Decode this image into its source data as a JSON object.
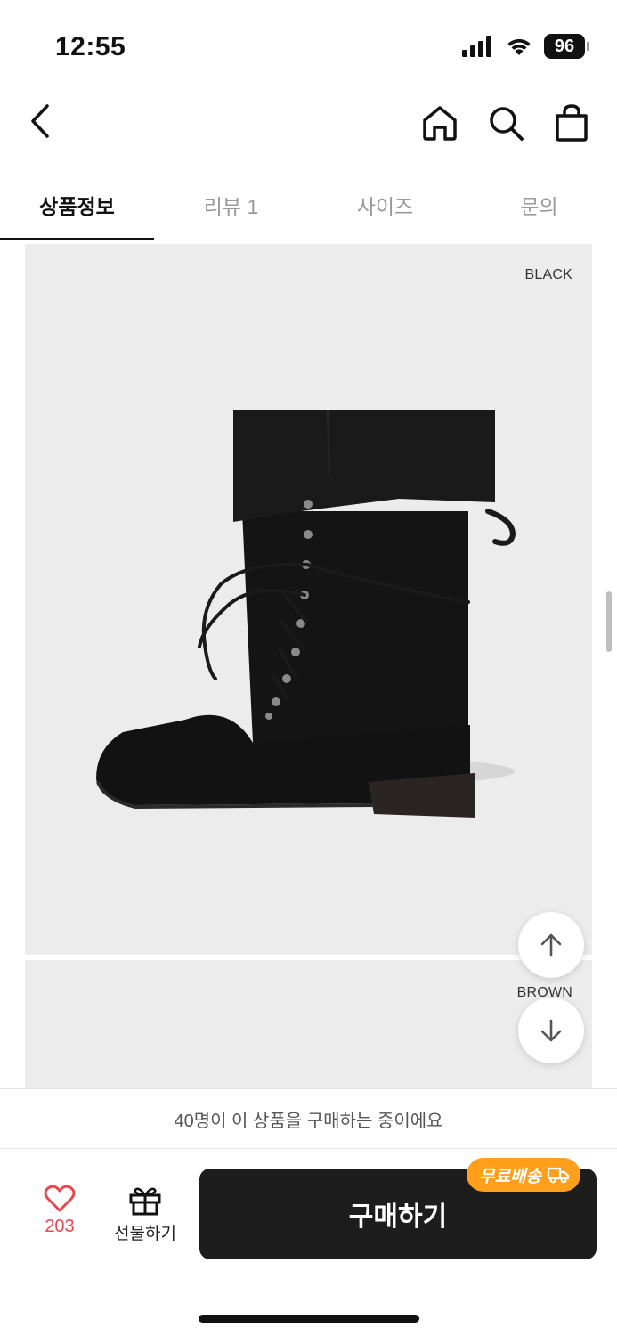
{
  "status_bar": {
    "time": "12:55",
    "battery": "96"
  },
  "header": {
    "back_icon": "chevron-left-icon",
    "home_icon": "home-icon",
    "search_icon": "search-icon",
    "bag_icon": "shopping-bag-icon"
  },
  "tabs": [
    {
      "label": "상품정보",
      "active": true
    },
    {
      "label": "리뷰 1",
      "active": false
    },
    {
      "label": "사이즈",
      "active": false
    },
    {
      "label": "문의",
      "active": false
    }
  ],
  "product_images": [
    {
      "color_label": "BLACK"
    },
    {
      "color_label": "BROWN"
    }
  ],
  "floating": {
    "up_icon": "arrow-up-icon",
    "down_icon": "arrow-down-icon"
  },
  "notice": "40명이 이 상품을 구매하는 중이에요",
  "action_bar": {
    "like_count": "203",
    "gift_label": "선물하기",
    "buy_label": "구매하기",
    "free_shipping_label": "무료배송"
  },
  "colors": {
    "accent_like": "#e8474f",
    "buy_button": "#1d1d1d",
    "free_shipping_badge": "#ff9f1c",
    "image_background": "#ececec"
  }
}
